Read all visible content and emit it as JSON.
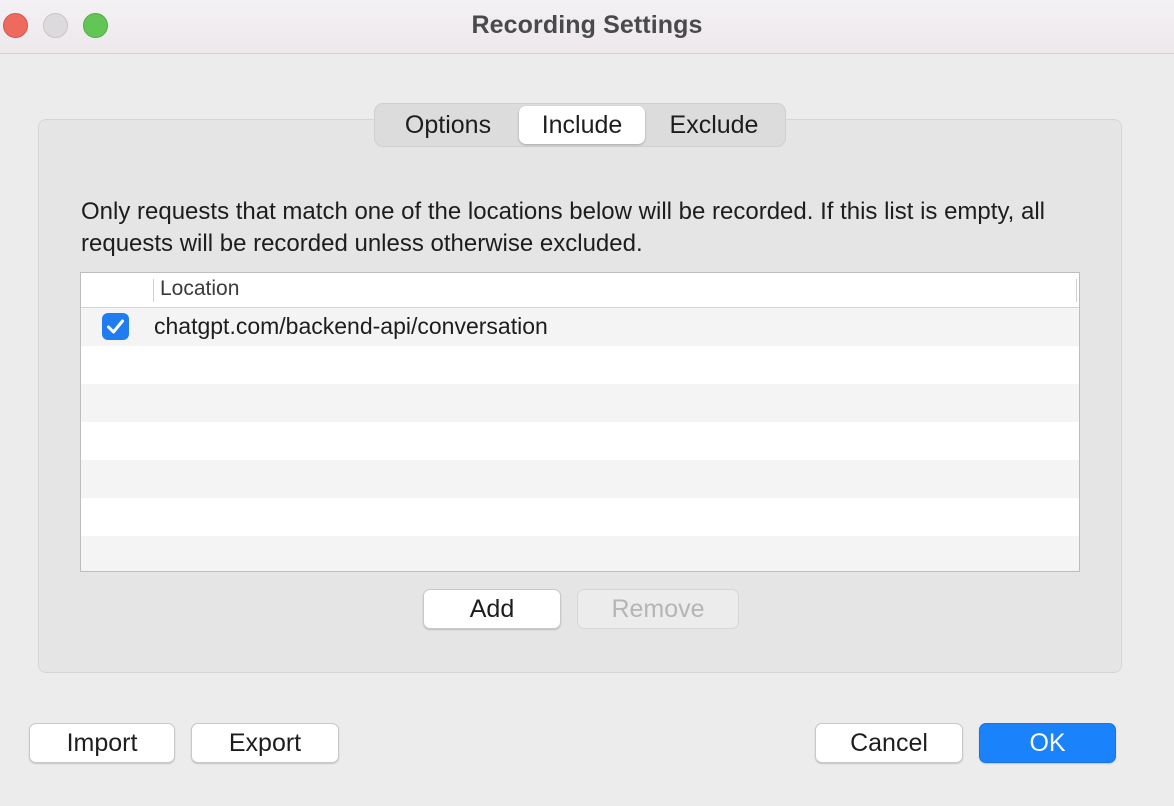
{
  "window": {
    "title": "Recording Settings"
  },
  "tabs": [
    {
      "label": "Options",
      "selected": false
    },
    {
      "label": "Include",
      "selected": true
    },
    {
      "label": "Exclude",
      "selected": false
    }
  ],
  "include": {
    "description": "Only requests that match one of the locations below will be recorded. If this list is empty, all requests will be recorded unless otherwise excluded.",
    "table": {
      "columns": [
        "",
        "Location"
      ],
      "rows": [
        {
          "enabled": true,
          "location": "chatgpt.com/backend-api/conversation"
        }
      ]
    },
    "add_label": "Add",
    "remove_label": "Remove"
  },
  "footer": {
    "import_label": "Import",
    "export_label": "Export",
    "cancel_label": "Cancel",
    "ok_label": "OK"
  },
  "colors": {
    "accent": "#1a82fb",
    "checkbox": "#1f7cf1",
    "close": "#ee6a5f",
    "zoom": "#62c555"
  },
  "icons": {
    "checkbox": "checkmark-icon"
  }
}
